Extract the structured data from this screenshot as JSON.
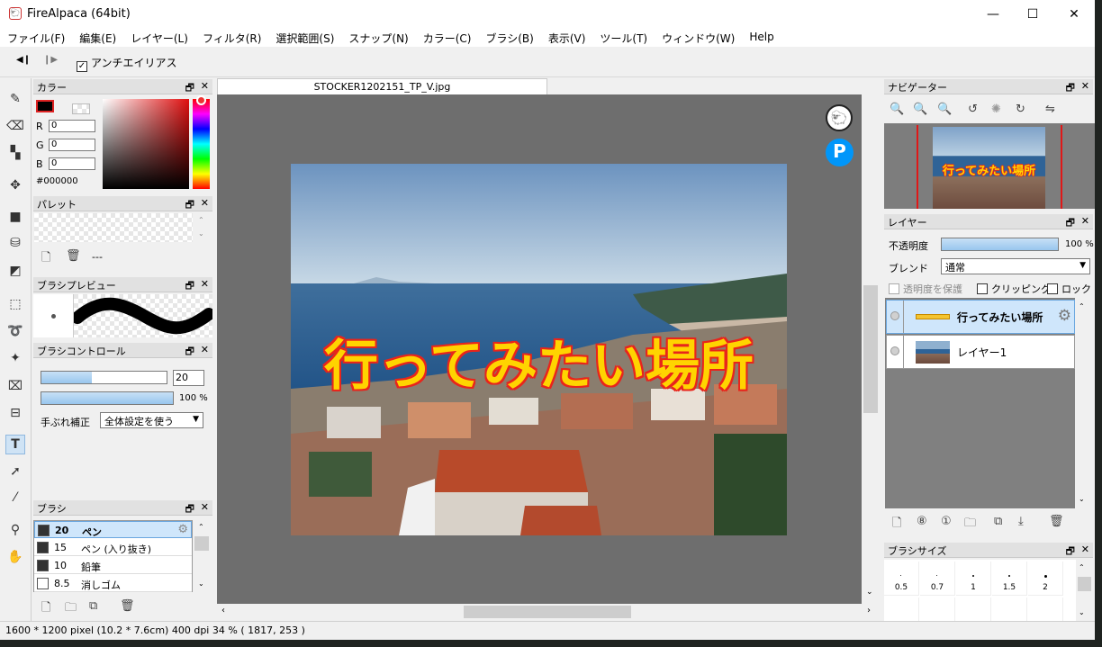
{
  "window": {
    "title": "FireAlpaca (64bit)",
    "minimize": "—",
    "maximize": "☐",
    "close": "✕"
  },
  "menu": [
    "ファイル(F)",
    "編集(E)",
    "レイヤー(L)",
    "フィルタ(R)",
    "選択範囲(S)",
    "スナップ(N)",
    "カラー(C)",
    "ブラシ(B)",
    "表示(V)",
    "ツール(T)",
    "ウィンドウ(W)",
    "Help"
  ],
  "toolbar": {
    "prev": "◀❙",
    "next": "❙▶",
    "antialias_label": "アンチエイリアス",
    "antialias_checked": "✓"
  },
  "tools": [
    "pen-icon",
    "eraser-icon",
    "dot-icon",
    "move-icon",
    "fill-rect-icon",
    "bucket-icon",
    "gradient-icon",
    "select-rect-icon",
    "lasso-icon",
    "magic-wand-icon",
    "select-pen-icon",
    "select-eraser-icon",
    "text-icon",
    "object-icon",
    "blur-icon",
    "eyedropper-icon",
    "hand-icon"
  ],
  "color_panel": {
    "title": "カラー",
    "r_label": "R",
    "g_label": "G",
    "b_label": "B",
    "r": "0",
    "g": "0",
    "b": "0",
    "hex": "#000000",
    "color": "#000000"
  },
  "palette_panel": {
    "title": "パレット",
    "dash": "---"
  },
  "brush_preview_panel": {
    "title": "ブラシプレビュー"
  },
  "brush_control_panel": {
    "title": "ブラシコントロール",
    "size": "20",
    "size_fraction": 0.4,
    "opacity": "100 %",
    "opacity_fraction": 1.0,
    "stabilizer_label": "手ぶれ補正",
    "stabilizer_value": "全体設定を使う"
  },
  "brush_panel": {
    "title": "ブラシ",
    "items": [
      {
        "size": "20",
        "name": "ペン",
        "selected": true,
        "color": "#333333"
      },
      {
        "size": "15",
        "name": "ペン (入り抜き)",
        "selected": false,
        "color": "#333333"
      },
      {
        "size": "10",
        "name": "鉛筆",
        "selected": false,
        "color": "#333333"
      },
      {
        "size": "8.5",
        "name": "消しゴム",
        "selected": false,
        "color": "#ffffff"
      }
    ]
  },
  "document": {
    "tab": "STOCKER1202151_TP_V.jpg",
    "overlay_text": "行ってみたい場所"
  },
  "navigator_panel": {
    "title": "ナビゲーター",
    "thumb_text": "行ってみたい場所"
  },
  "layer_panel": {
    "title": "レイヤー",
    "opacity_label": "不透明度",
    "opacity": "100 %",
    "opacity_fraction": 1.0,
    "blend_label": "ブレンド",
    "blend_value": "通常",
    "protect_alpha": "透明度を保護",
    "clipping": "クリッピング",
    "lock": "ロック",
    "layers": [
      {
        "name": "行ってみたい場所",
        "selected": true
      },
      {
        "name": "レイヤー1",
        "selected": false
      }
    ]
  },
  "brush_size_panel": {
    "title": "ブラシサイズ",
    "sizes": [
      "0.5",
      "0.7",
      "1",
      "1.5",
      "2"
    ]
  },
  "status": {
    "dims": "1600 * 1200 pixel",
    "cm": "(10.2 * 7.6cm)",
    "dpi": "400 dpi",
    "zoom": "34 %",
    "coords": "( 1817, 253 )"
  },
  "panel_ctl": {
    "float": "🗗",
    "close": "✕"
  }
}
